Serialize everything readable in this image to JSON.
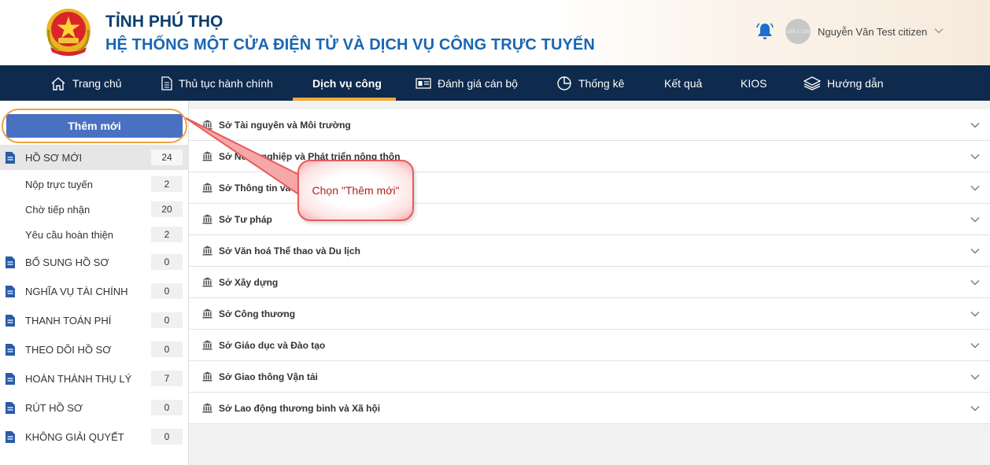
{
  "header": {
    "province": "TỈNH PHÚ THỌ",
    "system_title": "HỆ THỐNG MỘT CỬA ĐIỆN TỬ VÀ DỊCH VỤ CÔNG TRỰC TUYẾN",
    "avatar_text": "100 x 100",
    "username": "Nguyễn Văn Test citizen",
    "colors": {
      "title_dark": "#0a3d6e",
      "title_blue": "#1a66b3"
    }
  },
  "nav": {
    "items": [
      {
        "label": "Trang chủ",
        "icon": "home-icon"
      },
      {
        "label": "Thủ tục hành chính",
        "icon": "document-icon"
      },
      {
        "label": "Dịch vụ công",
        "icon": "",
        "active": true
      },
      {
        "label": "Đánh giá cán bộ",
        "icon": "id-card-icon"
      },
      {
        "label": "Thống kê",
        "icon": "pie-chart-icon"
      },
      {
        "label": "Kết quả",
        "icon": ""
      },
      {
        "label": "KIOS",
        "icon": ""
      },
      {
        "label": "Hướng dẫn",
        "icon": "layers-icon"
      }
    ],
    "colors": {
      "background": "#0e2a4d",
      "active_underline": "#f0a93a"
    }
  },
  "sidebar": {
    "add_button": "Thêm mới",
    "groups": [
      {
        "label": "HỒ SƠ MỚI",
        "count": "24",
        "active": true
      },
      {
        "label": "Nộp trực tuyến",
        "count": "2",
        "sub": true
      },
      {
        "label": "Chờ tiếp nhận",
        "count": "20",
        "sub": true
      },
      {
        "label": "Yêu cầu hoàn thiện",
        "count": "2",
        "sub": true
      },
      {
        "label": "BỔ SUNG HỒ SƠ",
        "count": "0"
      },
      {
        "label": "NGHĨA VỤ TÀI CHÍNH",
        "count": "0"
      },
      {
        "label": "THANH TOÁN PHÍ",
        "count": "0"
      },
      {
        "label": "THEO DÕI HỒ SƠ",
        "count": "0"
      },
      {
        "label": "HOÀN THÀNH THỤ LÝ",
        "count": "7"
      },
      {
        "label": "RÚT HỒ SƠ",
        "count": "0"
      },
      {
        "label": "KHÔNG GIẢI QUYẾT",
        "count": "0"
      }
    ],
    "colors": {
      "button": "#4a70c2",
      "doc_icon": "#2a5ba8",
      "highlight": "#f2a23c"
    }
  },
  "departments": [
    "Sở Tài nguyên và Môi trường",
    "Sở Nông nghiệp và Phát triển nông thôn",
    "Sở Thông tin và Truyền thông",
    "Sở Tư pháp",
    "Sở Văn hoá Thể thao và Du lịch",
    "Sở Xây dựng",
    "Sở Công thương",
    "Sở Giáo dục và Đào tạo",
    "Sở Giao thông Vận tải",
    "Sở Lao động thương binh và Xã hội"
  ],
  "callout": {
    "text": "Chọn \"Thêm mới\"",
    "colors": {
      "border": "#e65b5b",
      "text": "#b31d1d"
    }
  }
}
